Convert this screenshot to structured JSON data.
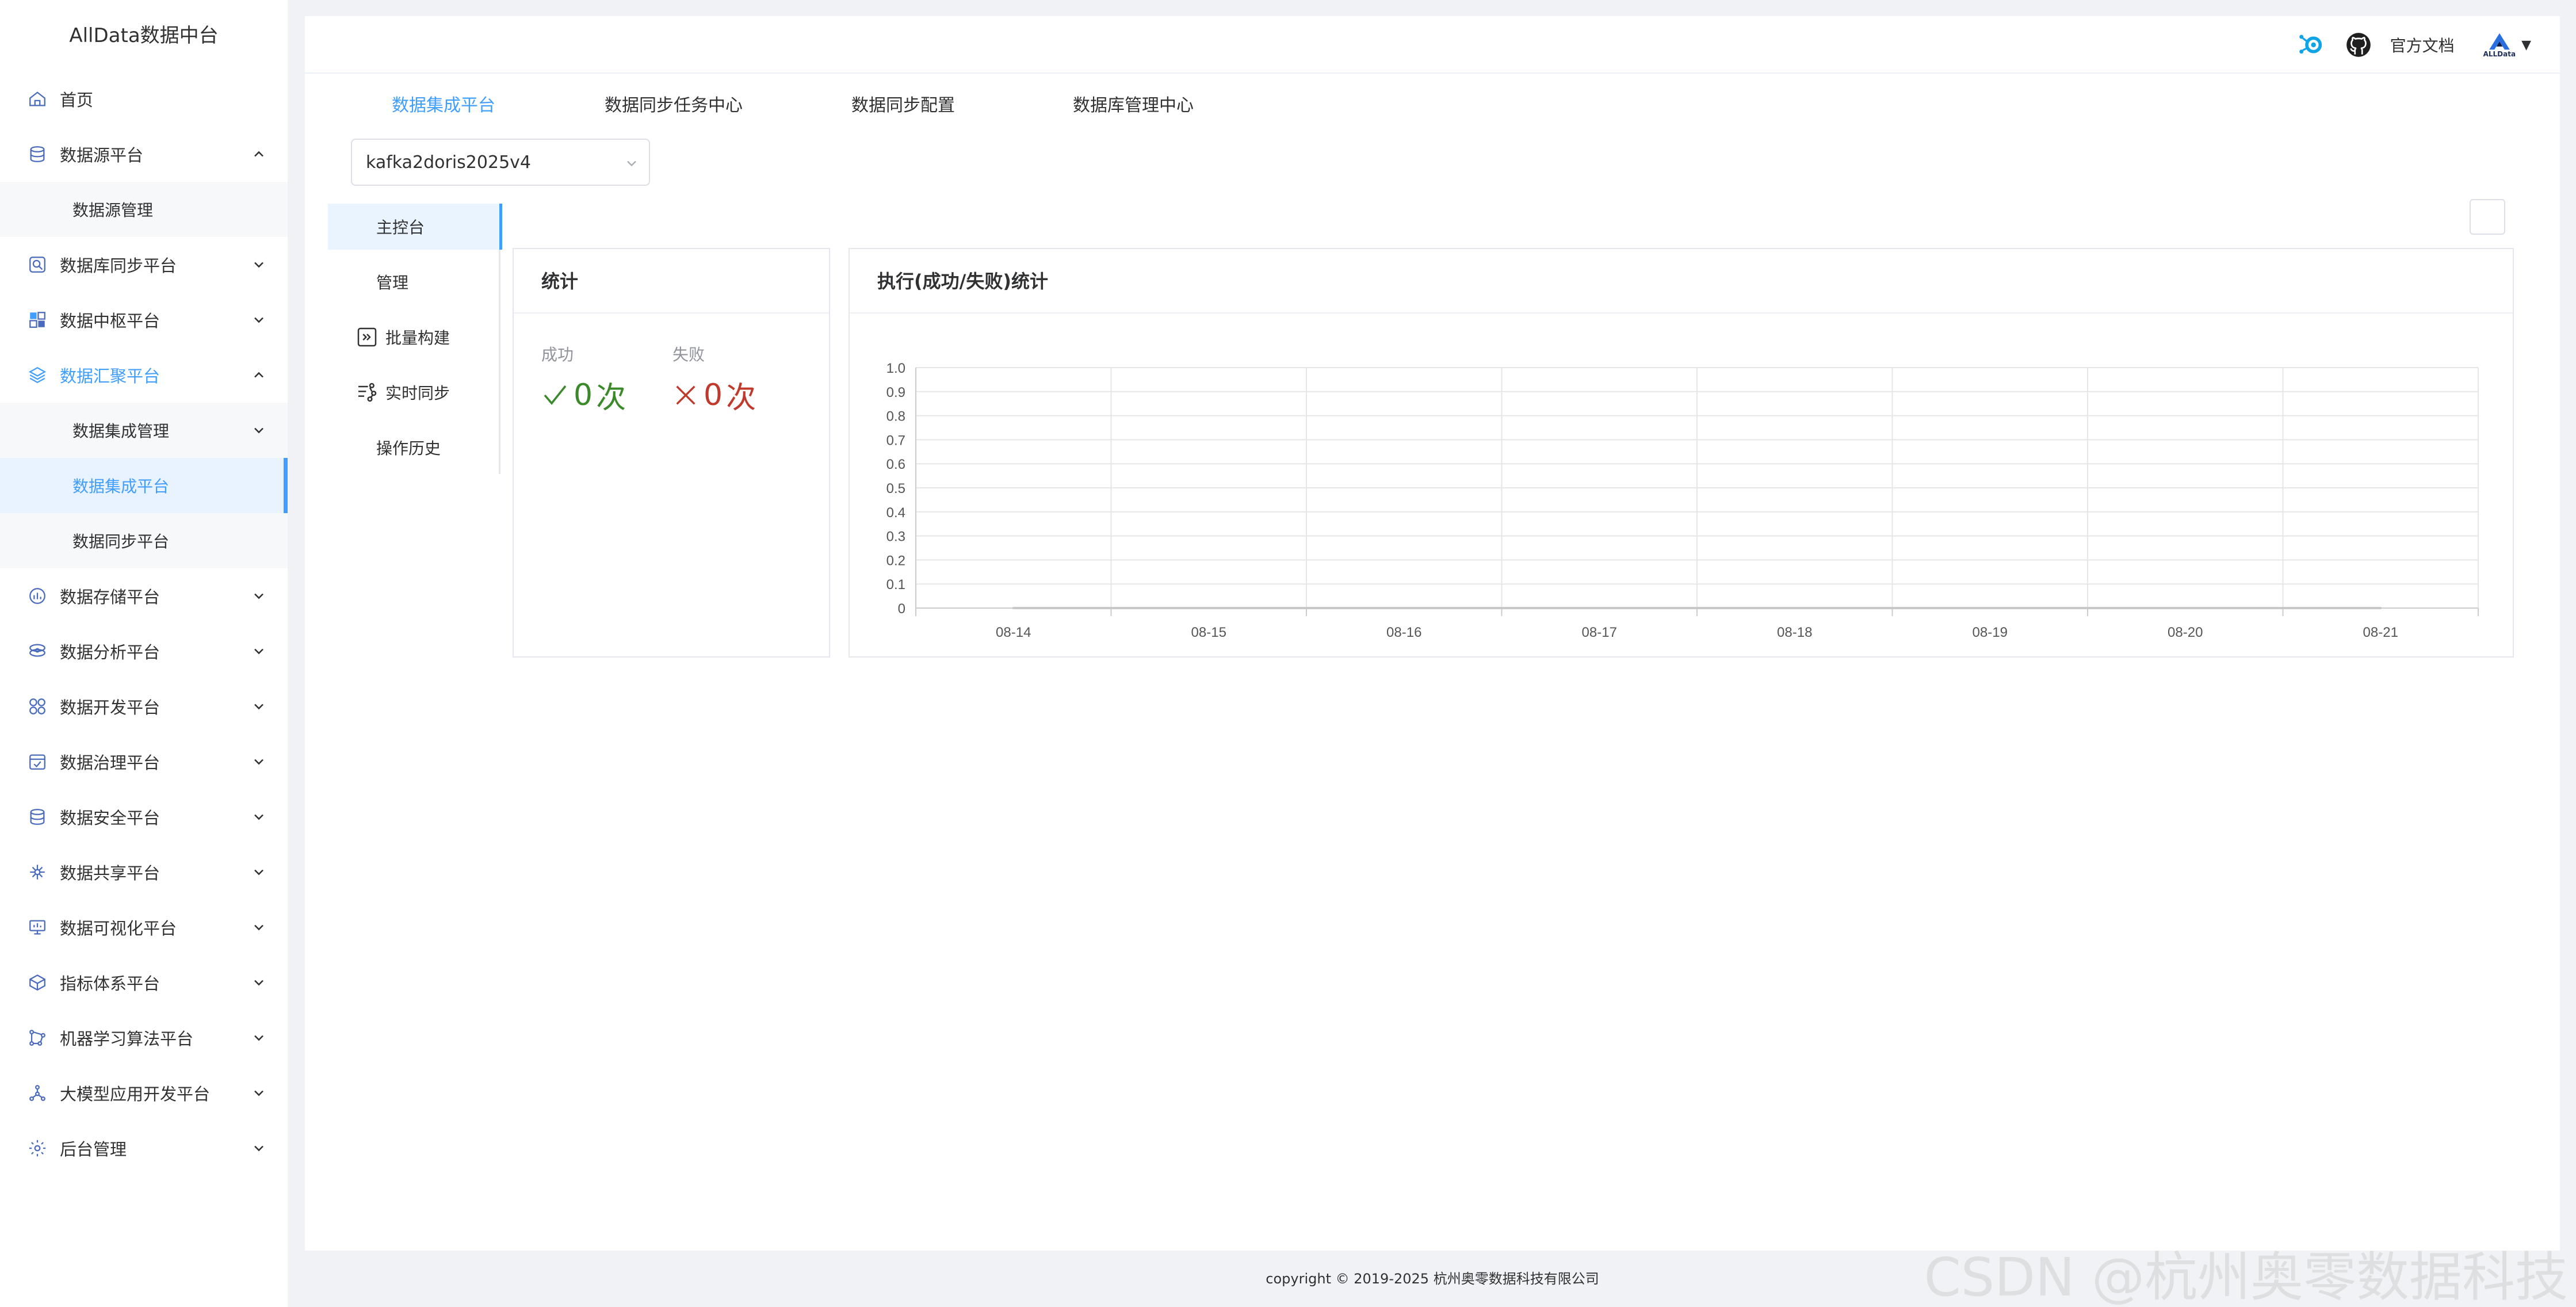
{
  "app": {
    "title": "AllData数据中台"
  },
  "sidebar": {
    "items": [
      {
        "label": "首页"
      },
      {
        "label": "数据源平台"
      },
      {
        "label": "数据源管理"
      },
      {
        "label": "数据库同步平台"
      },
      {
        "label": "数据中枢平台"
      },
      {
        "label": "数据汇聚平台"
      },
      {
        "label": "数据集成管理"
      },
      {
        "label": "数据集成平台"
      },
      {
        "label": "数据同步平台"
      },
      {
        "label": "数据存储平台"
      },
      {
        "label": "数据分析平台"
      },
      {
        "label": "数据开发平台"
      },
      {
        "label": "数据治理平台"
      },
      {
        "label": "数据安全平台"
      },
      {
        "label": "数据共享平台"
      },
      {
        "label": "数据可视化平台"
      },
      {
        "label": "指标体系平台"
      },
      {
        "label": "机器学习算法平台"
      },
      {
        "label": "大模型应用开发平台"
      },
      {
        "label": "后台管理"
      }
    ]
  },
  "header": {
    "docs_label": "官方文档",
    "logo_text": "ALLData",
    "dropdown_caret": "▼"
  },
  "top_tabs": [
    {
      "label": "数据集成平台"
    },
    {
      "label": "数据同步任务中心"
    },
    {
      "label": "数据同步配置"
    },
    {
      "label": "数据库管理中心"
    }
  ],
  "job_select": {
    "value": "kafka2doris2025v4"
  },
  "left_tabs": [
    {
      "label": "主控台"
    },
    {
      "label": "管理"
    },
    {
      "label": "批量构建"
    },
    {
      "label": "实时同步"
    },
    {
      "label": "操作历史"
    }
  ],
  "stats_panel": {
    "title": "统计",
    "success_label": "成功",
    "success_value": "0",
    "success_unit": "次",
    "fail_label": "失败",
    "fail_value": "0",
    "fail_unit": "次"
  },
  "exec_panel": {
    "title": "执行(成功/失败)统计"
  },
  "chart_data": {
    "type": "line",
    "title": "执行(成功/失败)统计",
    "categories": [
      "08-14",
      "08-15",
      "08-16",
      "08-17",
      "08-18",
      "08-19",
      "08-20",
      "08-21"
    ],
    "series": [
      {
        "values": [
          0,
          0,
          0,
          0,
          0,
          0,
          0,
          0
        ]
      }
    ],
    "yticks": [
      "0",
      "0.1",
      "0.2",
      "0.3",
      "0.4",
      "0.5",
      "0.6",
      "0.7",
      "0.8",
      "0.9",
      "1.0"
    ],
    "ylim": [
      0,
      1.0
    ],
    "grid": true,
    "colors": {
      "grid": "#e6e6e6",
      "axis": "#cccccc",
      "line": "#c8c8c8"
    }
  },
  "colors": {
    "accent": "#409eff",
    "success": "#3a8a2a",
    "fail": "#c0392b"
  },
  "footer": {
    "text": "copyright © 2019-2025 杭州奥零数据科技有限公司"
  },
  "watermark": {
    "text": "CSDN @杭州奥零数据科技"
  }
}
